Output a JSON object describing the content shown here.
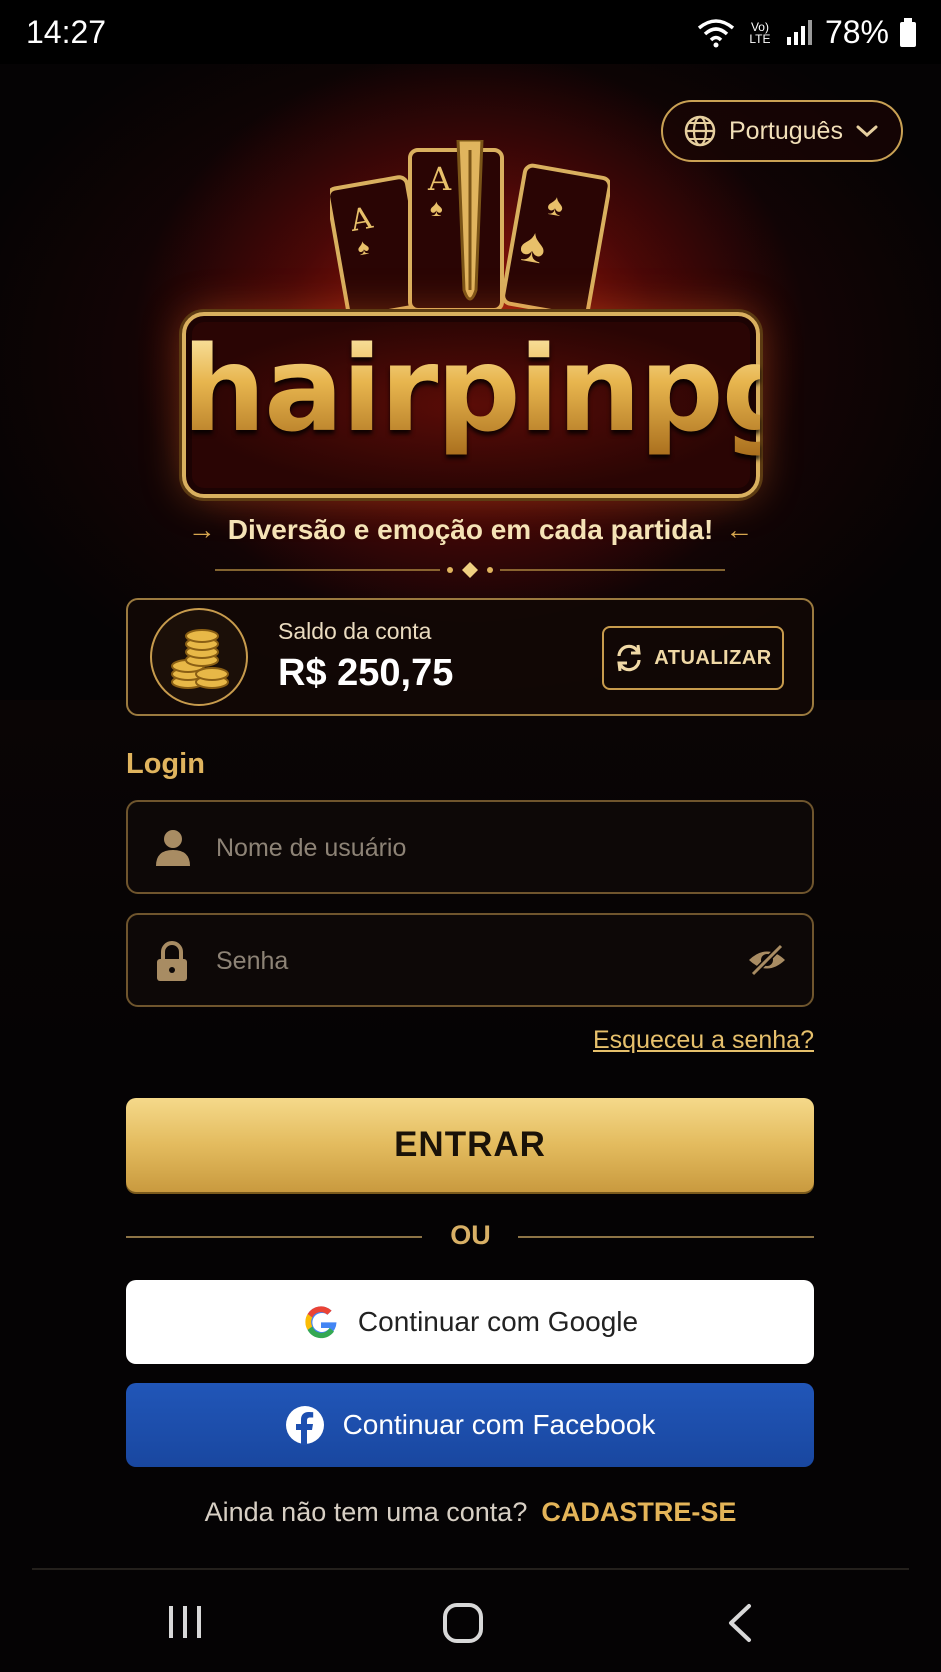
{
  "status_bar": {
    "time": "14:27",
    "network_label": "Vo) LTE",
    "battery": "78%"
  },
  "language": {
    "label": "Português"
  },
  "brand": {
    "name": "hairpinpg",
    "tagline": "Diversão e emoção em cada partida!"
  },
  "balance": {
    "label": "Saldo da conta",
    "value": "R$ 250,75",
    "refresh_label": "ATUALIZAR"
  },
  "login": {
    "section_label": "Login",
    "username_placeholder": "Nome de usuário",
    "password_placeholder": "Senha",
    "forgot_label": "Esqueceu a senha?",
    "submit_label": "ENTRAR"
  },
  "divider": {
    "label": "OU"
  },
  "social": {
    "google_label": "Continuar com Google",
    "facebook_label": "Continuar com Facebook"
  },
  "signup": {
    "prompt": "Ainda não tem uma conta?",
    "cta": "CADASTRE-SE"
  },
  "colors": {
    "gold": "#e0b45e",
    "facebook": "#1f51b0",
    "background": "#050304",
    "accent_red": "#8e1208"
  },
  "icons": [
    "globe-icon",
    "chevron-down-icon",
    "coins-icon",
    "refresh-icon",
    "user-icon",
    "lock-icon",
    "eye-off-icon",
    "google-icon",
    "facebook-icon",
    "recent-apps-icon",
    "home-icon",
    "back-icon"
  ]
}
